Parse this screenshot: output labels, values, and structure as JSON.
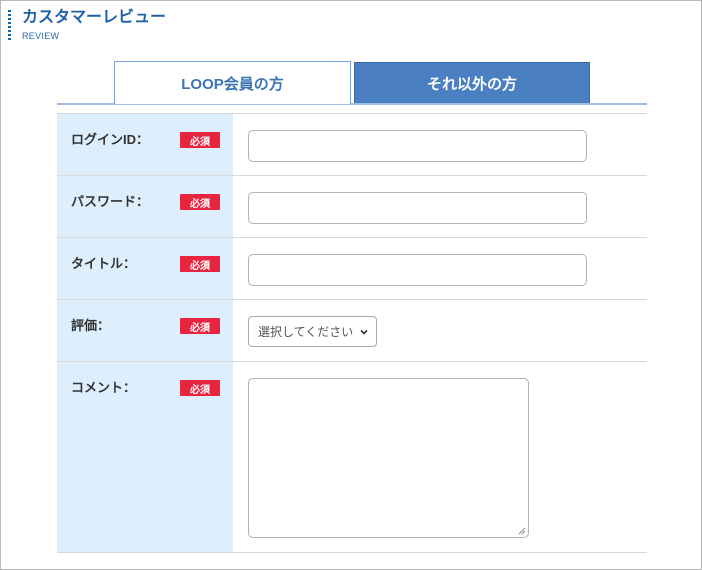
{
  "header": {
    "title": "カスタマーレビュー",
    "subtitle": "REVIEW"
  },
  "tabs": [
    {
      "label": "LOOP会員の方",
      "active": true
    },
    {
      "label": "それ以外の方",
      "active": false
    }
  ],
  "form": {
    "required_badge": "必須",
    "fields": [
      {
        "label": "ログインID：",
        "type": "text",
        "value": ""
      },
      {
        "label": "パスワード：",
        "type": "password",
        "value": ""
      },
      {
        "label": "タイトル：",
        "type": "text",
        "value": ""
      },
      {
        "label": "評価：",
        "type": "select",
        "selected": "選択してください"
      },
      {
        "label": "コメント：",
        "type": "textarea",
        "value": ""
      }
    ]
  },
  "colors": {
    "brand_blue": "#1f5fa6",
    "tab_active_text": "#3a74b7",
    "tab_inactive_bg": "#4a7fc1",
    "label_bg": "#ddeefd",
    "required_red": "#e8253e"
  },
  "icons": {
    "select_arrow": "chevron-down-icon",
    "resize": "resize-grip-icon"
  }
}
